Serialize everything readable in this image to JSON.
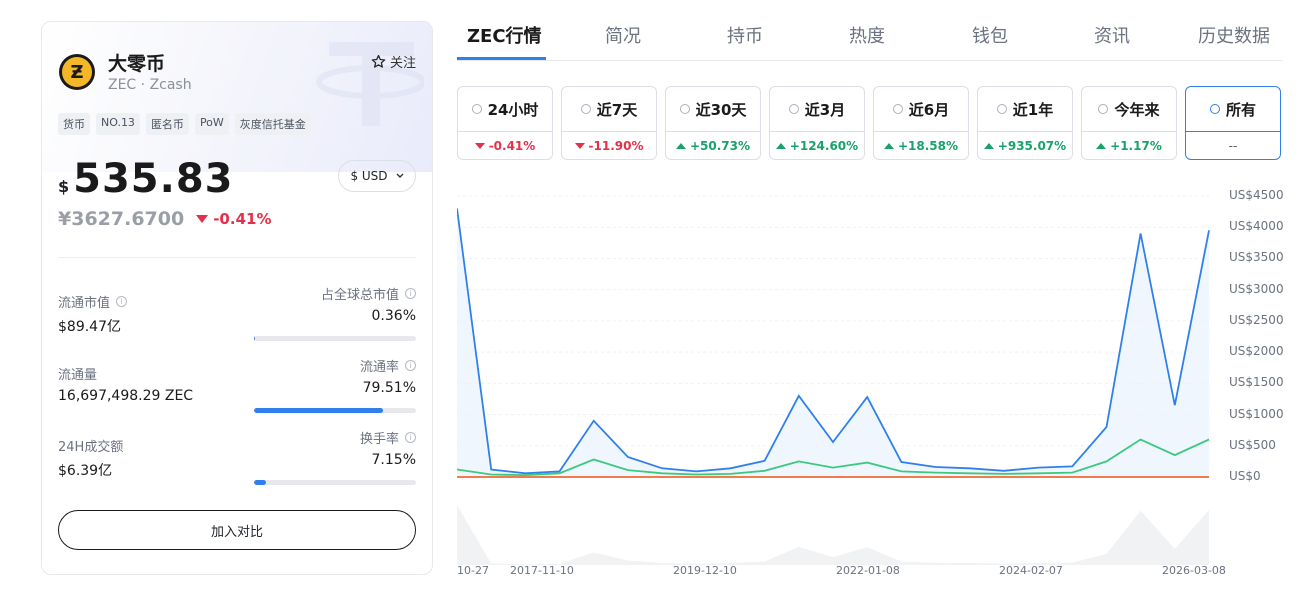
{
  "coin": {
    "logo_letter": "Ƶ",
    "name": "大零币",
    "subtitle": "ZEC · Zcash",
    "follow_label": "关注",
    "tags": [
      "货币",
      "NO.13",
      "匿名币",
      "PoW",
      "灰度信托基金"
    ],
    "price_symbol": "$",
    "price": "535.83",
    "currency_selector": "$ USD",
    "price_cny": "¥3627.6700",
    "change": "-0.41%"
  },
  "stats": {
    "market_cap_label": "流通市值",
    "market_cap_value": "$89.47亿",
    "global_share_label": "占全球总市值",
    "global_share_value": "0.36%",
    "global_share_fraction": 0.0036,
    "supply_label": "流通量",
    "supply_value": "16,697,498.29 ZEC",
    "circ_rate_label": "流通率",
    "circ_rate_value": "79.51%",
    "circ_rate_fraction": 0.7951,
    "volume_label": "24H成交额",
    "volume_value": "$6.39亿",
    "turnover_label": "换手率",
    "turnover_value": "7.15%",
    "turnover_fraction": 0.0715
  },
  "compare_button": "加入对比",
  "tabs": [
    "ZEC行情",
    "简况",
    "持币",
    "热度",
    "钱包",
    "资讯",
    "历史数据"
  ],
  "periods": [
    {
      "label": "24小时",
      "change": "-0.41%",
      "dir": "down"
    },
    {
      "label": "近7天",
      "change": "-11.90%",
      "dir": "down"
    },
    {
      "label": "近30天",
      "change": "+50.73%",
      "dir": "up"
    },
    {
      "label": "近3月",
      "change": "+124.60%",
      "dir": "up"
    },
    {
      "label": "近6月",
      "change": "+18.58%",
      "dir": "up"
    },
    {
      "label": "近1年",
      "change": "+935.07%",
      "dir": "up"
    },
    {
      "label": "今年来",
      "change": "+1.17%",
      "dir": "up"
    },
    {
      "label": "所有",
      "change": "--",
      "dir": "none"
    }
  ],
  "chart_data": {
    "type": "line",
    "y_ticks": [
      "US$4500",
      "US$4000",
      "US$3500",
      "US$3000",
      "US$2500",
      "US$2000",
      "US$1500",
      "US$1000",
      "US$500",
      "US$0"
    ],
    "ylim": [
      0,
      4500
    ],
    "x_ticks": [
      "10-27",
      "2017-11-10",
      "2019-12-10",
      "2022-01-08",
      "2024-02-07",
      "2026-03-08"
    ],
    "colors": {
      "price": "#2f80ed",
      "market": "#3cc97e",
      "volume": "#f06a35"
    },
    "series": [
      {
        "key": "price",
        "values": [
          4300,
          120,
          60,
          90,
          900,
          320,
          140,
          90,
          140,
          260,
          1300,
          560,
          1280,
          240,
          160,
          140,
          100,
          150,
          170,
          800,
          3900,
          1150,
          3950
        ]
      },
      {
        "key": "market",
        "values": [
          120,
          40,
          30,
          60,
          280,
          110,
          60,
          40,
          50,
          100,
          250,
          150,
          230,
          90,
          70,
          60,
          50,
          60,
          70,
          250,
          600,
          350,
          600
        ]
      },
      {
        "key": "volume",
        "values": [
          0,
          0,
          0,
          0,
          0,
          0,
          0,
          0,
          0,
          0,
          0,
          0,
          0,
          0,
          0,
          0,
          0,
          0,
          0,
          0,
          0,
          0,
          0
        ]
      }
    ]
  }
}
